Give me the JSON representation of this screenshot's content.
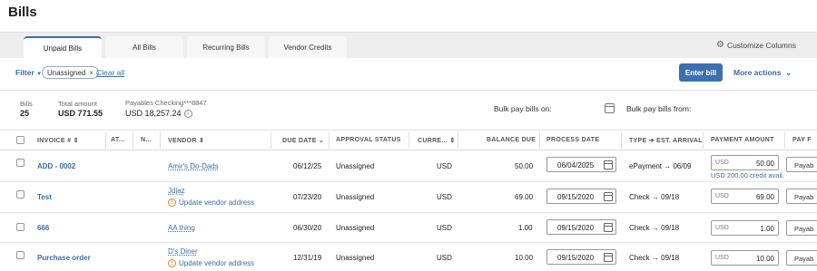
{
  "header": {
    "title": "Bills"
  },
  "tabs": [
    {
      "label": "Unpaid Bills",
      "active": true
    },
    {
      "label": "All Bills",
      "active": false
    },
    {
      "label": "Recurring Bills",
      "active": false
    },
    {
      "label": "Vendor Credits",
      "active": false
    }
  ],
  "toolbar": {
    "customize_columns": "Customize Columns",
    "filter_label": "Filter",
    "filter_chip": "Unassigned",
    "chip_close": "×",
    "clear_all": "Clear all",
    "enter_bill": "Enter bill",
    "more_actions": "More actions"
  },
  "summary": {
    "bills_label": "Bills",
    "bills_count": "25",
    "total_label": "Total amount",
    "total_value": "USD 771.55",
    "account_label": "Payables Checking***8847",
    "account_value": "USD 18,257.24",
    "bulk_pay_on": "Bulk pay bills on:",
    "bulk_pay_from": "Bulk pay bills from:"
  },
  "columns": {
    "invoice": "INVOICE #",
    "attachment": "AT...",
    "notes": "N...",
    "vendor": "VENDOR",
    "due_date": "DUE DATE",
    "approval": "APPROVAL STATUS",
    "currency": "CURRE...",
    "balance": "BALANCE DUE",
    "process_date": "PROCESS DATE",
    "type": "TYPE ➔ EST. ARRIVAL",
    "payment_amount": "PAYMENT AMOUNT",
    "pay_from": "PAY F"
  },
  "vendor_warning": "Update vendor address",
  "rows": [
    {
      "invoice": "ADD - 0002",
      "vendor": "Amir's Do-Dads",
      "due": "06/12/25",
      "approval": "Unassigned",
      "currency": "USD",
      "balance": "50.00",
      "process": "06/04/2025",
      "type": "ePayment → 06/09",
      "amt_currency": "USD",
      "amount": "50.00",
      "credit": "USD 200.00 credit avail.",
      "pay": "Payab"
    },
    {
      "invoice": "Test",
      "vendor": "Jdjaz",
      "due": "07/23/20",
      "approval": "Unassigned",
      "currency": "USD",
      "balance": "69.00",
      "process": "09/15/2020",
      "type": "Check → 09/18",
      "amt_currency": "USD",
      "amount": "69.00",
      "pay": "Payab"
    },
    {
      "invoice": "666",
      "vendor": "AA thing",
      "due": "06/30/20",
      "approval": "Unassigned",
      "currency": "USD",
      "balance": "1.00",
      "process": "09/15/2020",
      "type": "Check → 09/18",
      "amt_currency": "USD",
      "amount": "1.00",
      "pay": "Payab"
    },
    {
      "invoice": "Purchase order",
      "vendor": "D's Diner",
      "due": "12/31/19",
      "approval": "Unassigned",
      "currency": "USD",
      "balance": "10.00",
      "process": "09/15/2020",
      "type": "Check → 09/18",
      "amt_currency": "USD",
      "amount": "10.00",
      "pay": "Payab"
    }
  ]
}
